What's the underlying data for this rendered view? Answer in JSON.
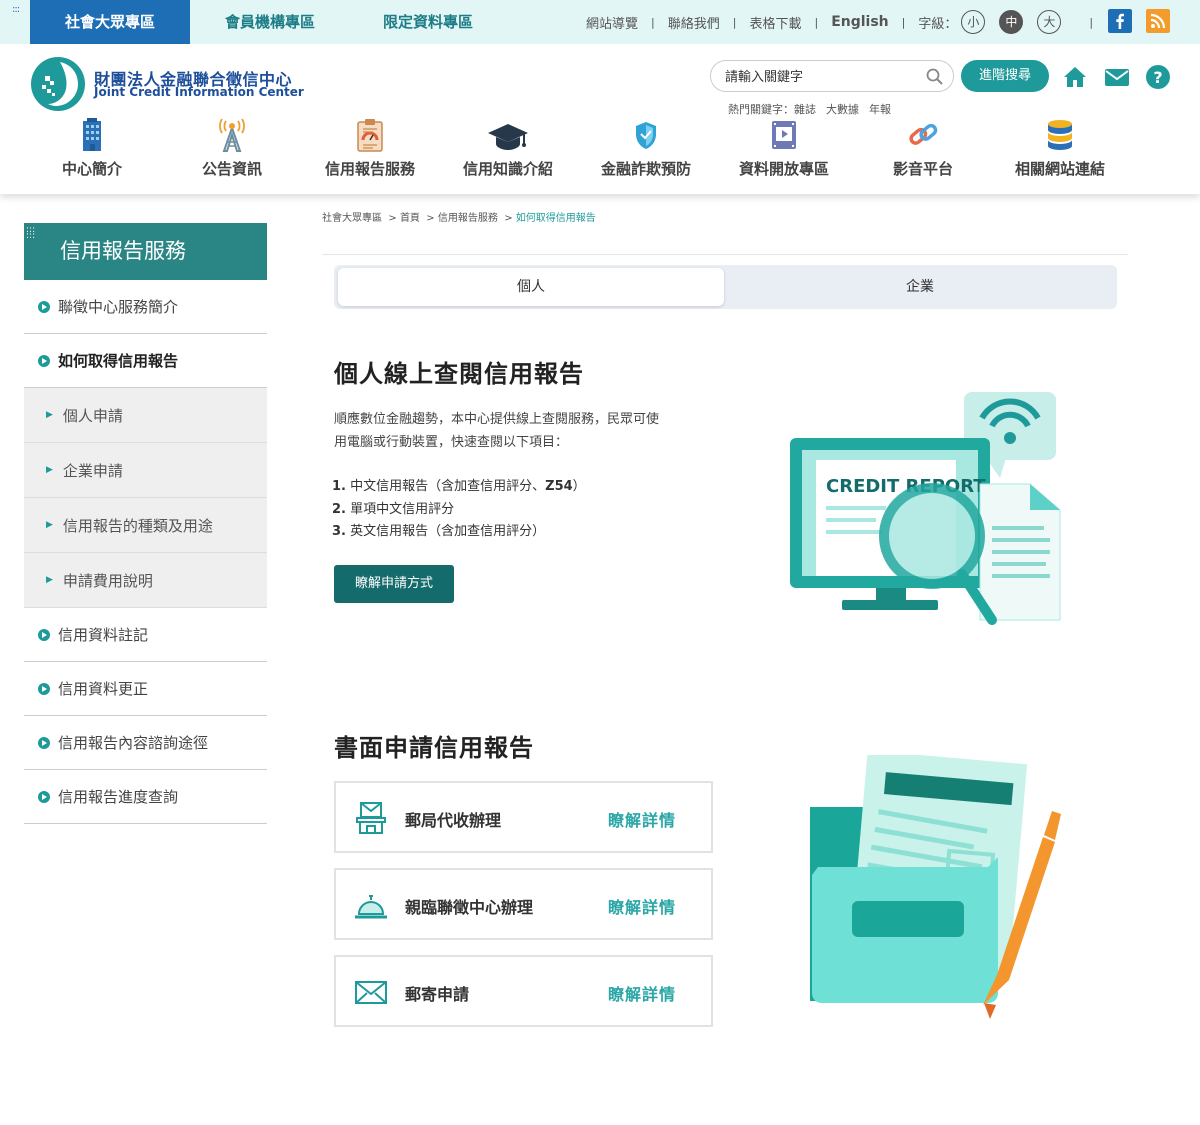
{
  "topbar": {
    "tabs": [
      "社會大眾專區",
      "會員機構專區",
      "限定資料專區"
    ],
    "links": [
      "網站導覽",
      "聯絡我們",
      "表格下載",
      "English"
    ],
    "font_size_label": "字級：",
    "font_sizes": [
      "小",
      "中",
      "大"
    ],
    "active_font_size": "中",
    "social": [
      "facebook-icon",
      "rss-icon"
    ]
  },
  "header": {
    "logo_zh": "財團法人金融聯合徵信中心",
    "logo_en": "Joint Credit Information Center",
    "search_placeholder": "請輸入關鍵字",
    "advanced_search": "進階搜尋",
    "hot_label": "熱門關鍵字：",
    "hot_keywords": [
      "雜誌",
      "大數據",
      "年報"
    ],
    "icons": [
      "home-icon",
      "mail-icon",
      "help-icon"
    ]
  },
  "nav": [
    {
      "label": "中心簡介",
      "icon": "building-icon"
    },
    {
      "label": "公告資訊",
      "icon": "broadcast-tower-icon"
    },
    {
      "label": "信用報告服務",
      "icon": "report-clipboard-icon"
    },
    {
      "label": "信用知識介紹",
      "icon": "graduation-cap-icon"
    },
    {
      "label": "金融詐欺預防",
      "icon": "shield-icon"
    },
    {
      "label": "資料開放專區",
      "icon": "video-file-icon"
    },
    {
      "label": "影音平台",
      "icon": "link-chain-icon"
    },
    {
      "label": "相關網站連結",
      "icon": "database-stack-icon"
    }
  ],
  "sidebar": {
    "title": "信用報告服務",
    "items": [
      {
        "label": "聯徵中心服務簡介",
        "active": false
      },
      {
        "label": "如何取得信用報告",
        "active": true,
        "subitems": [
          "個人申請",
          "企業申請",
          "信用報告的種類及用途",
          "申請費用說明"
        ]
      },
      {
        "label": "信用資料註記",
        "active": false
      },
      {
        "label": "信用資料更正",
        "active": false
      },
      {
        "label": "信用報告內容諮詢途徑",
        "active": false
      },
      {
        "label": "信用報告進度查詢",
        "active": false
      }
    ]
  },
  "breadcrumb": [
    "社會大眾專區",
    "首頁",
    "信用報告服務",
    "如何取得信用報告"
  ],
  "tabs": {
    "personal": "個人",
    "business": "企業",
    "active": "個人"
  },
  "online": {
    "title": "個人線上查閱信用報告",
    "intro_line1": "順應數位金融趨勢，本中心提供線上查閱服務，民眾可使",
    "intro_line2": "用電腦或行動裝置，快速查閱以下項目：",
    "items": [
      {
        "num": "1.",
        "pre": "中文信用報告（含加查信用評分、",
        "bold": "Z54",
        "post": "）"
      },
      {
        "num": "2.",
        "pre": "單項中文信用評分",
        "bold": "",
        "post": ""
      },
      {
        "num": "3.",
        "pre": "英文信用報告（含加查信用評分）",
        "bold": "",
        "post": ""
      }
    ],
    "button": "瞭解申請方式",
    "illustration_text": "CREDIT REPORT"
  },
  "paper": {
    "title": "書面申請信用報告",
    "cards": [
      {
        "label": "郵局代收辦理",
        "more": "瞭解詳情",
        "icon": "post-office-icon"
      },
      {
        "label": "親臨聯徵中心辦理",
        "more": "瞭解詳情",
        "icon": "service-bell-icon"
      },
      {
        "label": "郵寄申請",
        "more": "瞭解詳情",
        "icon": "envelope-icon"
      }
    ]
  },
  "colors": {
    "teal": "#1f9a9a",
    "dark_teal": "#146b6b",
    "blue": "#1d6eb5",
    "topbar_bg": "#e3f6f6"
  }
}
